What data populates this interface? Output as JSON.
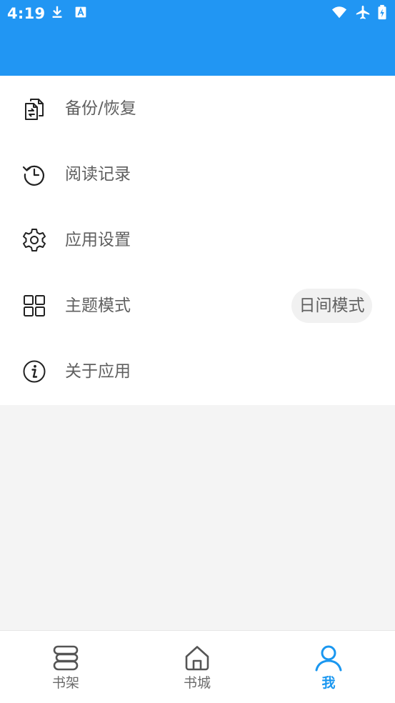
{
  "status_bar": {
    "time": "4:19",
    "icons": [
      "download-icon",
      "text-a-icon",
      "wifi-icon",
      "airplane-icon",
      "battery-charging-icon"
    ]
  },
  "colors": {
    "header": "#2196F3",
    "accent": "#1a97f0",
    "text": "#5f5f5f",
    "background": "#f4f4f4"
  },
  "menu": {
    "items": [
      {
        "label": "备份/恢复",
        "icon": "backup-restore-icon"
      },
      {
        "label": "阅读记录",
        "icon": "history-icon"
      },
      {
        "label": "应用设置",
        "icon": "gear-icon"
      },
      {
        "label": "主题模式",
        "icon": "grid-icon",
        "value": "日间模式"
      },
      {
        "label": "关于应用",
        "icon": "info-icon"
      }
    ]
  },
  "bottom_nav": {
    "items": [
      {
        "label": "书架",
        "icon": "bookshelf-icon",
        "active": false
      },
      {
        "label": "书城",
        "icon": "home-icon",
        "active": false
      },
      {
        "label": "我",
        "icon": "user-icon",
        "active": true
      }
    ]
  }
}
